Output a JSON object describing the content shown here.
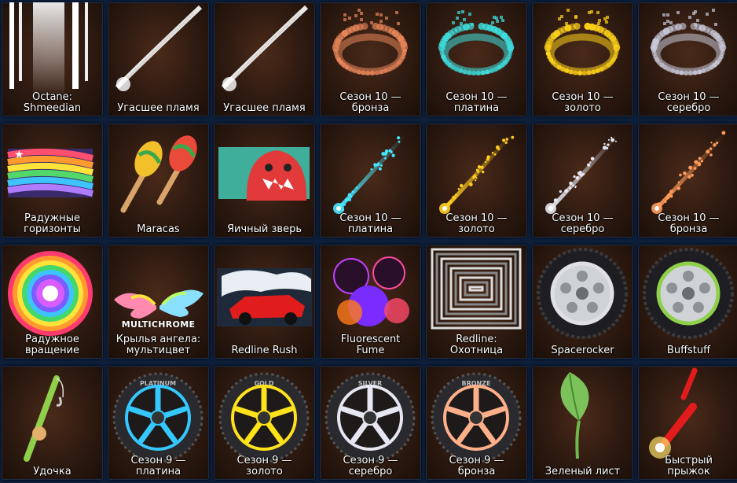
{
  "items": [
    {
      "icon": "octane-banner-icon",
      "label": "Octane:\nShmeedian"
    },
    {
      "icon": "white-flame-trail-icon",
      "label": "Угасшее пламя"
    },
    {
      "icon": "white-flame-trail-icon",
      "label": "Угасшее пламя"
    },
    {
      "icon": "season-ring-icon",
      "color": "#e8865a",
      "label": "Сезон 10 —\nбронза"
    },
    {
      "icon": "season-ring-icon",
      "color": "#3fe0e0",
      "label": "Сезон 10 —\nплатина"
    },
    {
      "icon": "season-ring-icon",
      "color": "#ffd21a",
      "label": "Сезон 10 —\nзолото"
    },
    {
      "icon": "season-ring-icon",
      "color": "#c8c8d8",
      "label": "Сезон 10 —\nсеребро"
    },
    {
      "icon": "rainbow-banner-icon",
      "label": "Радужные\nгоризонты"
    },
    {
      "icon": "maracas-icon",
      "label": "Maracas"
    },
    {
      "icon": "egg-beast-icon",
      "label": "Яичный зверь"
    },
    {
      "icon": "comet-trail-icon",
      "color": "#46e6ff",
      "label": "Сезон 10 —\nплатина"
    },
    {
      "icon": "comet-trail-icon",
      "color": "#ffcc22",
      "label": "Сезон 10 —\nзолото"
    },
    {
      "icon": "comet-trail-icon",
      "color": "#e6e6f0",
      "label": "Сезон 10 —\nсеребро"
    },
    {
      "icon": "comet-trail-icon",
      "color": "#ff9a5a",
      "label": "Сезон 10 —\nбронза"
    },
    {
      "icon": "rainbow-wheel-icon",
      "label": "Радужное\nвращение"
    },
    {
      "icon": "angel-wings-icon",
      "badge": "MULTICHROME",
      "label": "Крылья ангела:\nмультицвет"
    },
    {
      "icon": "red-car-decal-icon",
      "label": "Redline Rush"
    },
    {
      "icon": "fluorescent-smoke-icon",
      "label": "Fluorescent\nFume"
    },
    {
      "icon": "concentric-squares-icon",
      "label": "Redline:\nОхотница"
    },
    {
      "icon": "spacerocker-wheel-icon",
      "label": "Spacerocker"
    },
    {
      "icon": "buffstuff-wheel-icon",
      "label": "Buffstuff"
    },
    {
      "icon": "fishing-rod-icon",
      "label": "Удочка"
    },
    {
      "icon": "season-wheel-icon",
      "color": "#34c8ff",
      "tire": "PLATINUM",
      "label": "Сезон 9 —\nплатина"
    },
    {
      "icon": "season-wheel-icon",
      "color": "#ffe21a",
      "tire": "GOLD",
      "label": "Сезон 9 —\nзолото"
    },
    {
      "icon": "season-wheel-icon",
      "color": "#e6e6f0",
      "tire": "SILVER",
      "label": "Сезон 9 —\nсеребро"
    },
    {
      "icon": "season-wheel-icon",
      "color": "#ffb08a",
      "tire": "BRONZE",
      "label": "Сезон 9 —\nбронза"
    },
    {
      "icon": "green-leaf-icon",
      "label": "Зеленый лист"
    },
    {
      "icon": "dynamite-spark-icon",
      "label": "Быстрый\nпрыжок"
    }
  ]
}
